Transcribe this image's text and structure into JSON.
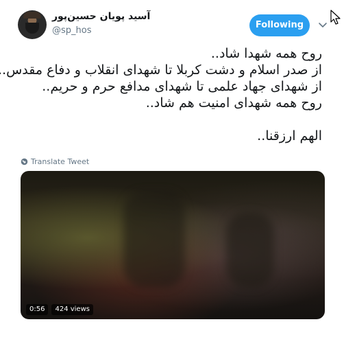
{
  "tweet": {
    "author": {
      "display_name": "آسید پویان حسین‌پور",
      "handle": "@sp_hos"
    },
    "follow_button_label": "Following",
    "text_lines": [
      "روح همه شهدا شاد..",
      "از صدر اسلام و دشت کربلا تا شهدای انقلاب و دفاع مقدس..",
      "از شهدای جهاد علمی تا شهدای مدافع حرم و حریم..",
      "روح همه شهدای امنیت هم شاد..",
      "",
      "الهم ارزقنا.."
    ],
    "translate_label": "Translate Tweet",
    "video": {
      "duration": "0:56",
      "views": "424 views"
    }
  },
  "colors": {
    "accent": "#2b9ff0",
    "muted_text": "#657786",
    "text": "#14171a"
  },
  "icons": [
    "avatar",
    "chevron-down-icon",
    "globe-icon",
    "mouse-cursor-icon"
  ]
}
